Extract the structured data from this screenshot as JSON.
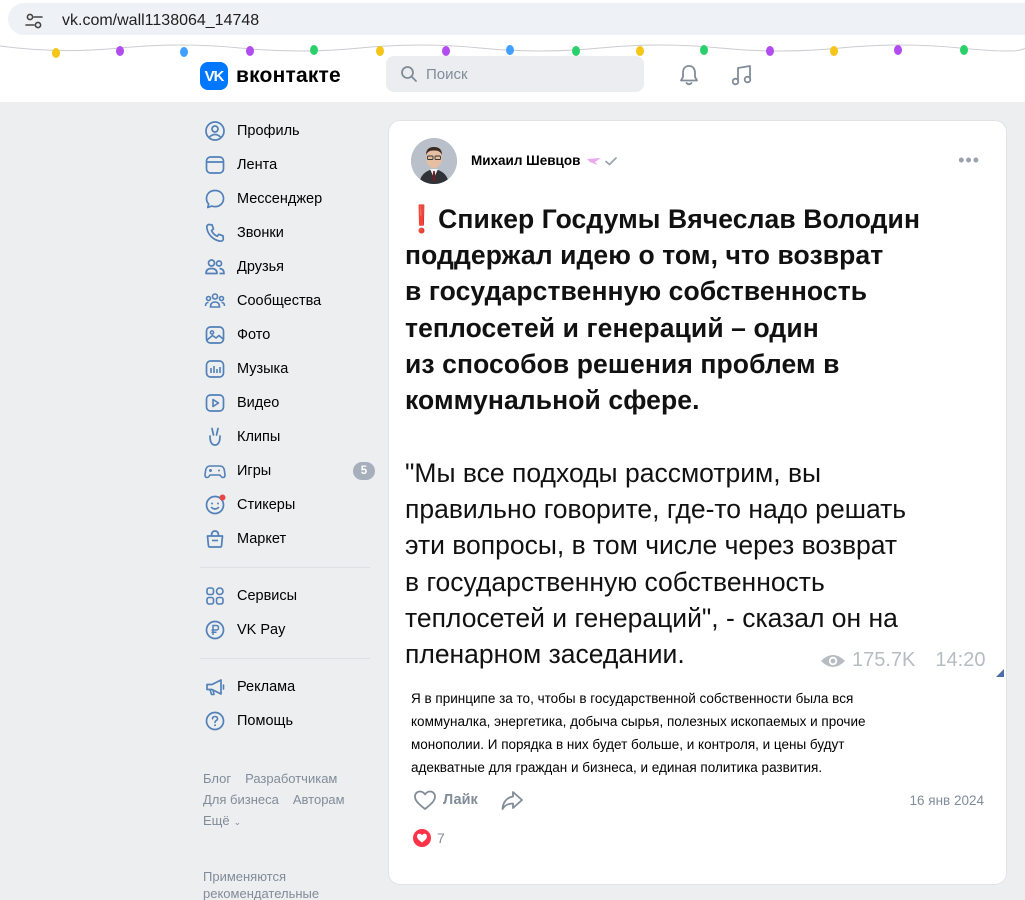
{
  "browser": {
    "url": "vk.com/wall1138064_14748"
  },
  "header": {
    "logo_mark": "VK",
    "logo_text": "вконтакте",
    "search_placeholder": "Поиск",
    "brand_color": "#0077ff"
  },
  "nav": {
    "items": [
      {
        "label": "Профиль",
        "icon": "profile-icon"
      },
      {
        "label": "Лента",
        "icon": "feed-icon"
      },
      {
        "label": "Мессенджер",
        "icon": "messenger-icon"
      },
      {
        "label": "Звонки",
        "icon": "phone-icon"
      },
      {
        "label": "Друзья",
        "icon": "friends-icon"
      },
      {
        "label": "Сообщества",
        "icon": "communities-icon"
      },
      {
        "label": "Фото",
        "icon": "photo-icon"
      },
      {
        "label": "Музыка",
        "icon": "music-icon"
      },
      {
        "label": "Видео",
        "icon": "video-icon"
      },
      {
        "label": "Клипы",
        "icon": "clips-icon"
      },
      {
        "label": "Игры",
        "icon": "games-icon",
        "badge": "5"
      },
      {
        "label": "Стикеры",
        "icon": "stickers-icon"
      },
      {
        "label": "Маркет",
        "icon": "market-icon"
      }
    ],
    "services": [
      {
        "label": "Сервисы",
        "icon": "services-icon"
      },
      {
        "label": "VK Pay",
        "icon": "vkpay-icon"
      }
    ],
    "misc": [
      {
        "label": "Реклама",
        "icon": "ads-icon"
      },
      {
        "label": "Помощь",
        "icon": "help-icon"
      }
    ],
    "footer": {
      "blog": "Блог",
      "developers": "Разработчикам",
      "business": "Для бизнеса",
      "authors": "Авторам",
      "more": "Ещё"
    },
    "note_line1": "Применяются",
    "note_line2": "рекомендательные"
  },
  "post": {
    "author": "Михаил Шевцов",
    "headline_mark": "❗",
    "headline_lines": [
      "Спикер Госдумы Вячеслав Володин",
      "поддержал идею о том, что возврат",
      "в государственную собственность",
      "теплосетей и генераций – один",
      "из способов решения проблем в",
      "коммунальной сфере."
    ],
    "quote_lines": [
      "\"Мы все подходы рассмотрим, вы",
      "правильно говорите, где-то надо решать",
      "эти вопросы, в том числе через возврат",
      "в государственную собственность",
      "теплосетей и генераций\", - сказал он на",
      "пленарном заседании."
    ],
    "views": "175.7K",
    "time": "14:20",
    "body_lines": [
      "Я в принципе за то, чтобы в государственной собственности была вся",
      "коммуналка, энергетика, добыча сырья, полезных ископаемых и прочие",
      "монополии. И порядка в них будет больше, и контроля, и цены будут",
      "адекватные для граждан и бизнеса, и единая политика развития."
    ],
    "like_label": "Лайк",
    "date": "16 янв 2024",
    "reactions_count": "7",
    "accent_red": "#e0232e"
  }
}
